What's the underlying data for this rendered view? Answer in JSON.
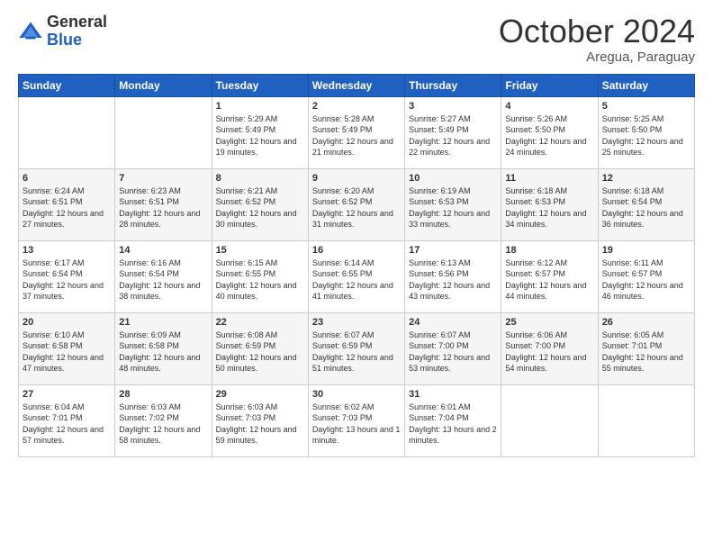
{
  "logo": {
    "general": "General",
    "blue": "Blue"
  },
  "header": {
    "month": "October 2024",
    "location": "Aregua, Paraguay"
  },
  "days_of_week": [
    "Sunday",
    "Monday",
    "Tuesday",
    "Wednesday",
    "Thursday",
    "Friday",
    "Saturday"
  ],
  "weeks": [
    [
      {
        "day": "",
        "sunrise": "",
        "sunset": "",
        "daylight": ""
      },
      {
        "day": "",
        "sunrise": "",
        "sunset": "",
        "daylight": ""
      },
      {
        "day": "1",
        "sunrise": "Sunrise: 5:29 AM",
        "sunset": "Sunset: 5:49 PM",
        "daylight": "Daylight: 12 hours and 19 minutes."
      },
      {
        "day": "2",
        "sunrise": "Sunrise: 5:28 AM",
        "sunset": "Sunset: 5:49 PM",
        "daylight": "Daylight: 12 hours and 21 minutes."
      },
      {
        "day": "3",
        "sunrise": "Sunrise: 5:27 AM",
        "sunset": "Sunset: 5:49 PM",
        "daylight": "Daylight: 12 hours and 22 minutes."
      },
      {
        "day": "4",
        "sunrise": "Sunrise: 5:26 AM",
        "sunset": "Sunset: 5:50 PM",
        "daylight": "Daylight: 12 hours and 24 minutes."
      },
      {
        "day": "5",
        "sunrise": "Sunrise: 5:25 AM",
        "sunset": "Sunset: 5:50 PM",
        "daylight": "Daylight: 12 hours and 25 minutes."
      }
    ],
    [
      {
        "day": "6",
        "sunrise": "Sunrise: 6:24 AM",
        "sunset": "Sunset: 6:51 PM",
        "daylight": "Daylight: 12 hours and 27 minutes."
      },
      {
        "day": "7",
        "sunrise": "Sunrise: 6:23 AM",
        "sunset": "Sunset: 6:51 PM",
        "daylight": "Daylight: 12 hours and 28 minutes."
      },
      {
        "day": "8",
        "sunrise": "Sunrise: 6:21 AM",
        "sunset": "Sunset: 6:52 PM",
        "daylight": "Daylight: 12 hours and 30 minutes."
      },
      {
        "day": "9",
        "sunrise": "Sunrise: 6:20 AM",
        "sunset": "Sunset: 6:52 PM",
        "daylight": "Daylight: 12 hours and 31 minutes."
      },
      {
        "day": "10",
        "sunrise": "Sunrise: 6:19 AM",
        "sunset": "Sunset: 6:53 PM",
        "daylight": "Daylight: 12 hours and 33 minutes."
      },
      {
        "day": "11",
        "sunrise": "Sunrise: 6:18 AM",
        "sunset": "Sunset: 6:53 PM",
        "daylight": "Daylight: 12 hours and 34 minutes."
      },
      {
        "day": "12",
        "sunrise": "Sunrise: 6:18 AM",
        "sunset": "Sunset: 6:54 PM",
        "daylight": "Daylight: 12 hours and 36 minutes."
      }
    ],
    [
      {
        "day": "13",
        "sunrise": "Sunrise: 6:17 AM",
        "sunset": "Sunset: 6:54 PM",
        "daylight": "Daylight: 12 hours and 37 minutes."
      },
      {
        "day": "14",
        "sunrise": "Sunrise: 6:16 AM",
        "sunset": "Sunset: 6:54 PM",
        "daylight": "Daylight: 12 hours and 38 minutes."
      },
      {
        "day": "15",
        "sunrise": "Sunrise: 6:15 AM",
        "sunset": "Sunset: 6:55 PM",
        "daylight": "Daylight: 12 hours and 40 minutes."
      },
      {
        "day": "16",
        "sunrise": "Sunrise: 6:14 AM",
        "sunset": "Sunset: 6:55 PM",
        "daylight": "Daylight: 12 hours and 41 minutes."
      },
      {
        "day": "17",
        "sunrise": "Sunrise: 6:13 AM",
        "sunset": "Sunset: 6:56 PM",
        "daylight": "Daylight: 12 hours and 43 minutes."
      },
      {
        "day": "18",
        "sunrise": "Sunrise: 6:12 AM",
        "sunset": "Sunset: 6:57 PM",
        "daylight": "Daylight: 12 hours and 44 minutes."
      },
      {
        "day": "19",
        "sunrise": "Sunrise: 6:11 AM",
        "sunset": "Sunset: 6:57 PM",
        "daylight": "Daylight: 12 hours and 46 minutes."
      }
    ],
    [
      {
        "day": "20",
        "sunrise": "Sunrise: 6:10 AM",
        "sunset": "Sunset: 6:58 PM",
        "daylight": "Daylight: 12 hours and 47 minutes."
      },
      {
        "day": "21",
        "sunrise": "Sunrise: 6:09 AM",
        "sunset": "Sunset: 6:58 PM",
        "daylight": "Daylight: 12 hours and 48 minutes."
      },
      {
        "day": "22",
        "sunrise": "Sunrise: 6:08 AM",
        "sunset": "Sunset: 6:59 PM",
        "daylight": "Daylight: 12 hours and 50 minutes."
      },
      {
        "day": "23",
        "sunrise": "Sunrise: 6:07 AM",
        "sunset": "Sunset: 6:59 PM",
        "daylight": "Daylight: 12 hours and 51 minutes."
      },
      {
        "day": "24",
        "sunrise": "Sunrise: 6:07 AM",
        "sunset": "Sunset: 7:00 PM",
        "daylight": "Daylight: 12 hours and 53 minutes."
      },
      {
        "day": "25",
        "sunrise": "Sunrise: 6:06 AM",
        "sunset": "Sunset: 7:00 PM",
        "daylight": "Daylight: 12 hours and 54 minutes."
      },
      {
        "day": "26",
        "sunrise": "Sunrise: 6:05 AM",
        "sunset": "Sunset: 7:01 PM",
        "daylight": "Daylight: 12 hours and 55 minutes."
      }
    ],
    [
      {
        "day": "27",
        "sunrise": "Sunrise: 6:04 AM",
        "sunset": "Sunset: 7:01 PM",
        "daylight": "Daylight: 12 hours and 57 minutes."
      },
      {
        "day": "28",
        "sunrise": "Sunrise: 6:03 AM",
        "sunset": "Sunset: 7:02 PM",
        "daylight": "Daylight: 12 hours and 58 minutes."
      },
      {
        "day": "29",
        "sunrise": "Sunrise: 6:03 AM",
        "sunset": "Sunset: 7:03 PM",
        "daylight": "Daylight: 12 hours and 59 minutes."
      },
      {
        "day": "30",
        "sunrise": "Sunrise: 6:02 AM",
        "sunset": "Sunset: 7:03 PM",
        "daylight": "Daylight: 13 hours and 1 minute."
      },
      {
        "day": "31",
        "sunrise": "Sunrise: 6:01 AM",
        "sunset": "Sunset: 7:04 PM",
        "daylight": "Daylight: 13 hours and 2 minutes."
      },
      {
        "day": "",
        "sunrise": "",
        "sunset": "",
        "daylight": ""
      },
      {
        "day": "",
        "sunrise": "",
        "sunset": "",
        "daylight": ""
      }
    ]
  ]
}
